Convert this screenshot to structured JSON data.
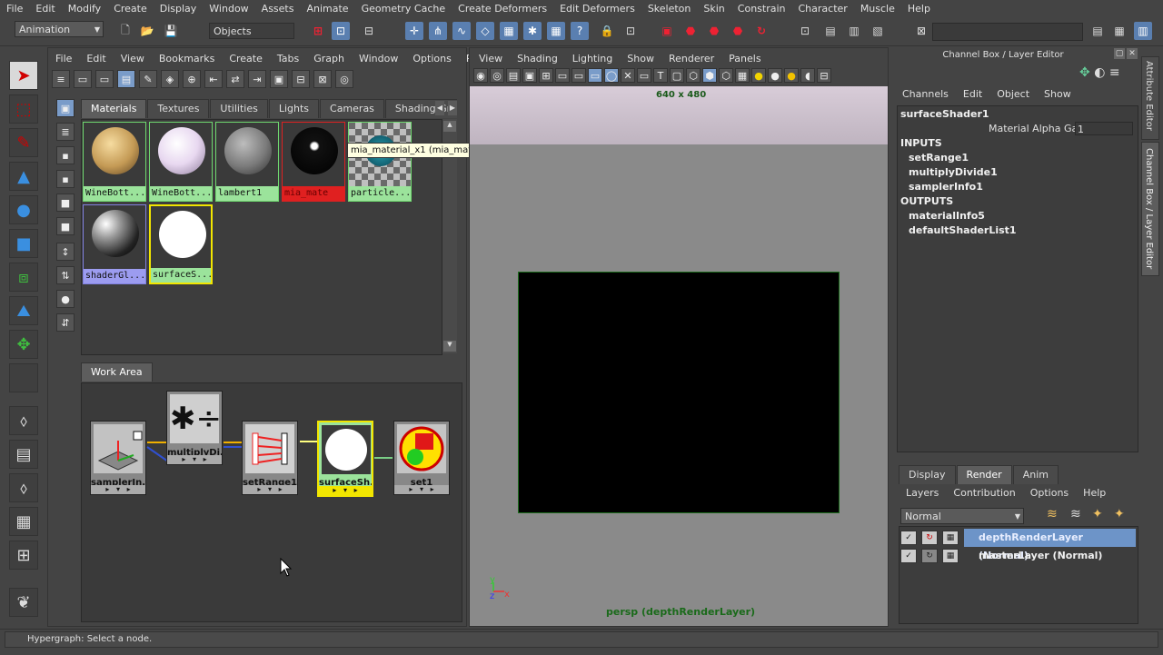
{
  "main_menu": [
    "File",
    "Edit",
    "Modify",
    "Create",
    "Display",
    "Window",
    "Assets",
    "Animate",
    "Geometry Cache",
    "Create Deformers",
    "Edit Deformers",
    "Skeleton",
    "Skin",
    "Constrain",
    "Character",
    "Muscle",
    "Help"
  ],
  "status_line": {
    "menu_set": "Animation",
    "selection_mode": "Objects"
  },
  "hypershade": {
    "menu": [
      "File",
      "Edit",
      "View",
      "Bookmarks",
      "Create",
      "Tabs",
      "Graph",
      "Window",
      "Options",
      "Panels"
    ],
    "tabs": [
      "Materials",
      "Textures",
      "Utilities",
      "Lights",
      "Cameras",
      "Shading Grc"
    ],
    "active_tab": "Materials",
    "swatches": [
      {
        "label": "WineBott...",
        "ball": "radial-gradient(circle at 40% 35%, #f6dca0, #c49a55 55%, #5a4020)",
        "label_bg": "#9be39b"
      },
      {
        "label": "WineBott...",
        "ball": "radial-gradient(circle at 40% 35%, #ffffff, #e8d8f0 50%, #8c7a99)",
        "label_bg": "#9be39b"
      },
      {
        "label": "lambert1",
        "ball": "radial-gradient(circle at 40% 35%, #bdbdbd, #7a7a7a 55%, #2e2e2e)",
        "label_bg": "#9be39b"
      },
      {
        "label": "mia_mate",
        "ball": "radial-gradient(circle at 50% 40%, #ffffff 0, #ffffff 8%, #111 12%, #000)",
        "label_bg": "#e02020"
      },
      {
        "label": "particle...",
        "ball": "checker",
        "label_bg": "#9be39b"
      },
      {
        "label": "shaderGl...",
        "ball": "radial-gradient(circle at 30% 30%, #ffffff, #9a9a9a 30%, #222 70%, #000)",
        "label_bg": "#9c9cf0"
      },
      {
        "label": "surfaceS...",
        "ball": "#ffffff",
        "label_bg": "#9be39b"
      }
    ],
    "tooltip": "mia_material_x1 (mia_material_x)",
    "work_area_tab": "Work Area",
    "nodes": [
      {
        "label": "samplerIn..."
      },
      {
        "label": "multiplyDi..."
      },
      {
        "label": "setRange1"
      },
      {
        "label": "surfaceSh..."
      },
      {
        "label": "set1"
      }
    ]
  },
  "viewport": {
    "menu": [
      "View",
      "Shading",
      "Lighting",
      "Show",
      "Renderer",
      "Panels"
    ],
    "resolution": "640 x 480",
    "camera_label": "persp (depthRenderLayer)",
    "axis_y": "y",
    "axis_x": "x",
    "axis_z": "z"
  },
  "channel_box": {
    "title": "Channel Box / Layer Editor",
    "menu": [
      "Channels",
      "Edit",
      "Object",
      "Show"
    ],
    "node_name": "surfaceShader1",
    "attr_label": "Material Alpha Gain",
    "attr_value": "1",
    "inputs_header": "INPUTS",
    "inputs": [
      "setRange1",
      "multiplyDivide1",
      "samplerInfo1"
    ],
    "outputs_header": "OUTPUTS",
    "outputs": [
      "materialInfo5",
      "defaultShaderList1"
    ],
    "side_tabs": [
      "Attribute Editor",
      "Channel Box / Layer Editor"
    ]
  },
  "layer_editor": {
    "tabs": [
      "Display",
      "Render",
      "Anim"
    ],
    "active_tab": "Render",
    "menu": [
      "Layers",
      "Contribution",
      "Options",
      "Help"
    ],
    "blend_mode": "Normal",
    "layers": [
      {
        "name": "depthRenderLayer (Normal)",
        "selected": true
      },
      {
        "name": "masterLayer (Normal)",
        "selected": false
      }
    ]
  },
  "help_line": "Hypergraph: Select a node."
}
